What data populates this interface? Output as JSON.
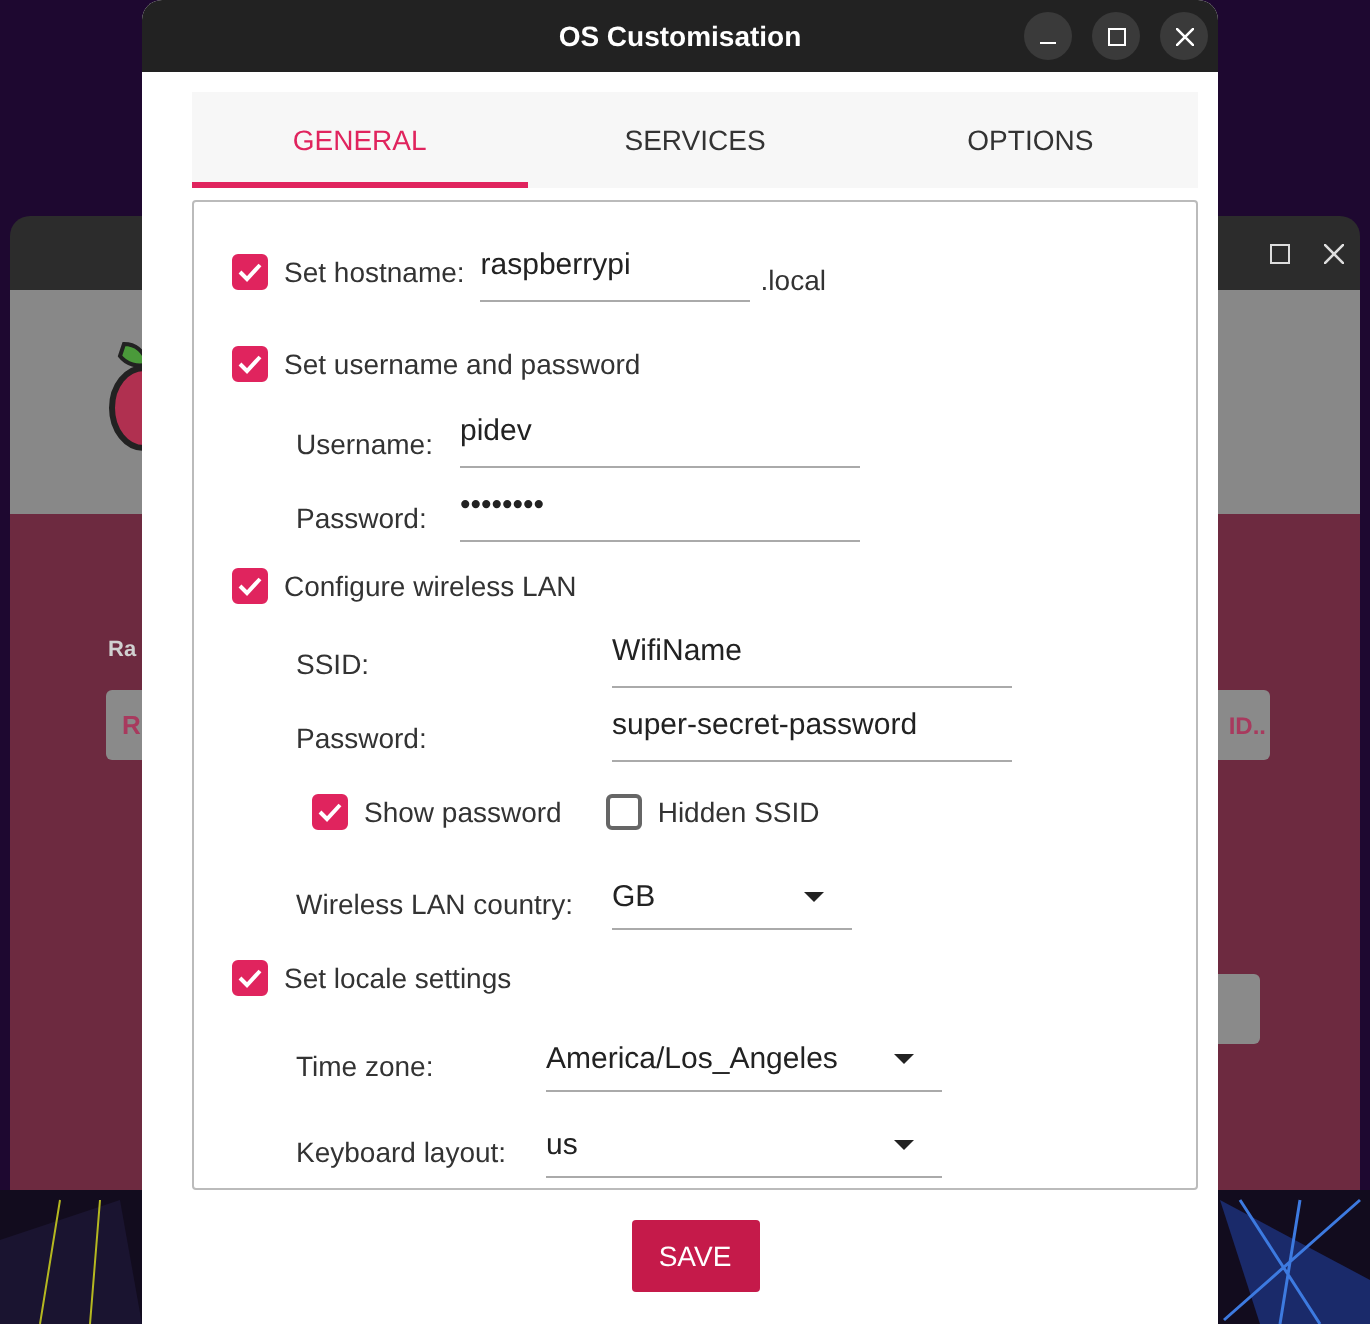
{
  "background_window": {
    "label": "Ra",
    "buttons": [
      "R",
      "ID.."
    ]
  },
  "window": {
    "title": "OS Customisation"
  },
  "tabs": [
    {
      "label": "GENERAL",
      "selected": true
    },
    {
      "label": "SERVICES",
      "selected": false
    },
    {
      "label": "OPTIONS",
      "selected": false
    }
  ],
  "sections": [
    {
      "label": "Set hostname:",
      "checked": true,
      "value": "raspberrypi",
      "suffix": ".local"
    },
    {
      "label": "Set username and password",
      "checked": true,
      "rows": [
        {
          "kind": "field",
          "label": "Username:",
          "value": "pidev"
        },
        {
          "kind": "field",
          "label": "Password:",
          "value": "••••••••"
        }
      ]
    },
    {
      "label": "Configure wireless LAN",
      "checked": true,
      "rows": [
        {
          "kind": "field",
          "label": "SSID:",
          "value": "WifiName"
        },
        {
          "kind": "field",
          "label": "Password:",
          "value": "super-secret-password"
        },
        {
          "kind": "options",
          "options": [
            {
              "label": "Show password",
              "checked": true
            },
            {
              "label": "Hidden SSID",
              "checked": false
            }
          ]
        },
        {
          "kind": "select",
          "label": "Wireless LAN country:",
          "value": "GB"
        }
      ]
    },
    {
      "label": "Set locale settings",
      "checked": true,
      "rows": [
        {
          "kind": "select",
          "label": "Time zone:",
          "value": "America/Los_Angeles"
        },
        {
          "kind": "select",
          "label": "Keyboard layout:",
          "value": "us"
        }
      ]
    }
  ],
  "save_button": "SAVE"
}
